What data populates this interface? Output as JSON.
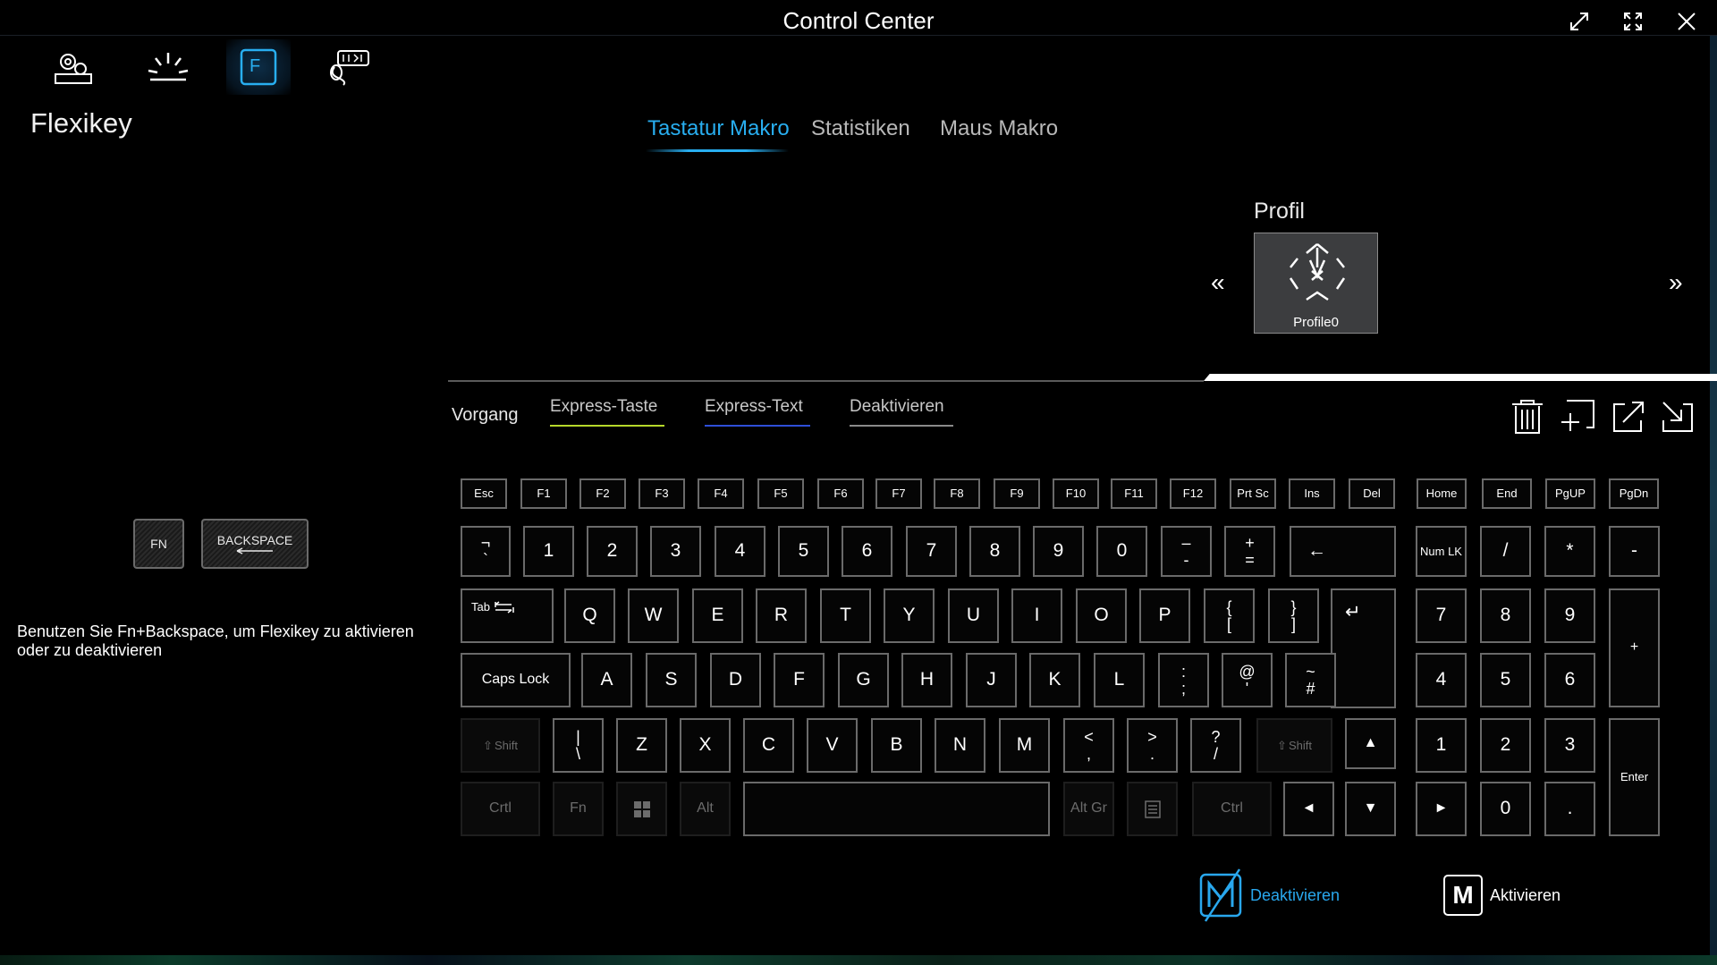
{
  "window": {
    "title": "Control Center"
  },
  "nav": {
    "section_title": "Flexikey",
    "active_icon": "flexikey-icon"
  },
  "tabs": [
    {
      "label": "Tastatur Makro",
      "active": true
    },
    {
      "label": "Statistiken",
      "active": false
    },
    {
      "label": "Maus Makro",
      "active": false
    }
  ],
  "profile": {
    "label": "Profil",
    "name": "Profile0",
    "prev": "«",
    "next": "»"
  },
  "subtabs": {
    "vorgang": "Vorgang",
    "items": [
      {
        "label": "Express-Taste",
        "color": "#b6d82a"
      },
      {
        "label": "Express-Text",
        "color": "#2e4fd8"
      },
      {
        "label": "Deaktivieren",
        "color": "#8a8a8a"
      }
    ]
  },
  "indicator": {
    "fn": "FN",
    "backspace": "BACKSPACE"
  },
  "hint": "Benutzen Sie Fn+Backspace, um Flexikey zu aktivieren oder zu deaktivieren",
  "keys": {
    "row0": [
      "Esc",
      "F1",
      "F2",
      "F3",
      "F4",
      "F5",
      "F6",
      "F7",
      "F8",
      "F9",
      "F10",
      "F11",
      "F12",
      "Prt Sc",
      "Ins",
      "Del",
      "Home",
      "End",
      "PgUP",
      "PgDn"
    ],
    "row1": [
      "1",
      "2",
      "3",
      "4",
      "5",
      "6",
      "7",
      "8",
      "9",
      "0"
    ],
    "row1_sym": {
      "backtick_top": "¬",
      "backtick_bottom": "`",
      "minus_top": "–",
      "minus_bottom": "-",
      "equal_top": "+",
      "equal_bottom": "=",
      "backspace": "←"
    },
    "numpad_row1": [
      "Num LK",
      "/",
      "*",
      "-"
    ],
    "tab": "Tab",
    "row2": [
      "Q",
      "W",
      "E",
      "R",
      "T",
      "Y",
      "U",
      "I",
      "O",
      "P"
    ],
    "row2_sym": {
      "lbrace_top": "{",
      "lbrace_bottom": "[",
      "rbrace_top": "}",
      "rbrace_bottom": "]",
      "enter": "↵"
    },
    "numpad_row2": [
      "7",
      "8",
      "9",
      "+"
    ],
    "caps": "Caps Lock",
    "row3": [
      "A",
      "S",
      "D",
      "F",
      "G",
      "H",
      "J",
      "K",
      "L"
    ],
    "row3_sym": {
      "semi_top": ":",
      "semi_bottom": ";",
      "quote_top": "@",
      "quote_bottom": "'",
      "hash_top": "~",
      "hash_bottom": "#"
    },
    "numpad_row3": [
      "4",
      "5",
      "6"
    ],
    "shift": "Shift",
    "row4_sym": {
      "bslash_top": "|",
      "bslash_bottom": "\\",
      "comma_top": "<",
      "comma_bottom": ",",
      "period_top": ">",
      "period_bottom": ".",
      "slash_top": "?",
      "slash_bottom": "/"
    },
    "row4": [
      "Z",
      "X",
      "C",
      "V",
      "B",
      "N",
      "M"
    ],
    "arrow_up": "▲",
    "numpad_row4": [
      "1",
      "2",
      "3",
      "Enter"
    ],
    "row5": {
      "ctrl": "Crtl",
      "fn": "Fn",
      "alt": "Alt",
      "altgr": "Alt Gr",
      "ctrl_r": "Ctrl",
      "left": "◄",
      "down": "▼",
      "right": "►"
    },
    "numpad_row5": [
      "0",
      "."
    ]
  },
  "bottom": {
    "deactivate": "Deaktivieren",
    "activate": "Aktivieren",
    "activate_letter": "M"
  },
  "colors": {
    "accent": "#28aef0",
    "background": "#000000"
  }
}
